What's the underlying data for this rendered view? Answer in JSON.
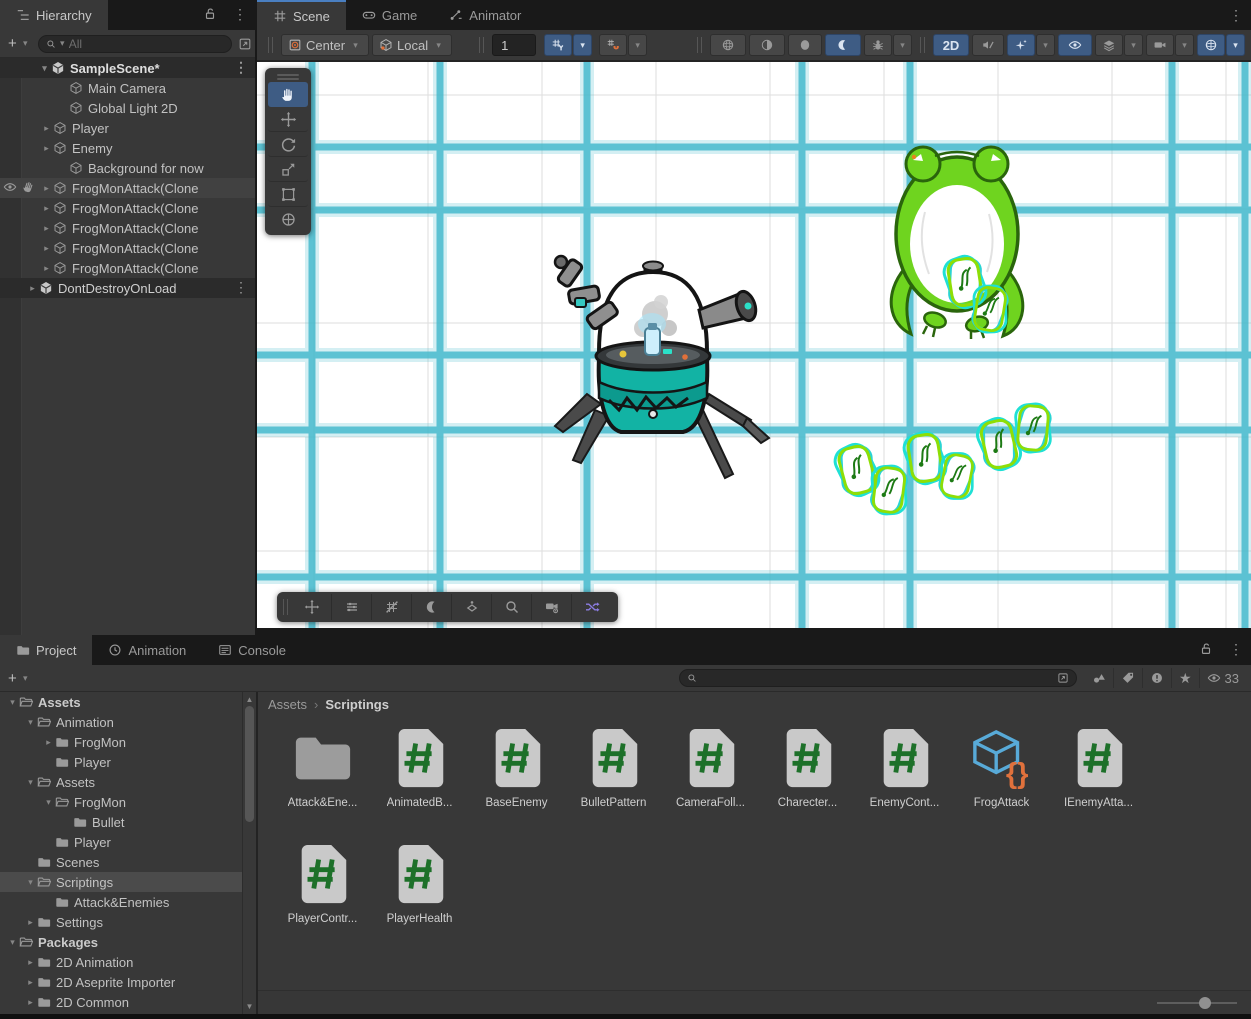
{
  "icons": {
    "kebab": "⋮",
    "caret": "▾",
    "tri_open": "▾",
    "tri_closed": "▸",
    "plus": "+",
    "star": "★",
    "crumb_sep": "›",
    "scroll_up": "▲",
    "scroll_down": "▼"
  },
  "hierarchy": {
    "tab_label": "Hierarchy",
    "search_placeholder": "All",
    "scene_header": "SampleScene*",
    "items": [
      {
        "label": "Main Camera"
      },
      {
        "label": "Global Light 2D"
      },
      {
        "label": "Player"
      },
      {
        "label": "Enemy"
      },
      {
        "label": "Background for now"
      },
      {
        "label": "FrogMonAttack(Clone"
      },
      {
        "label": "FrogMonAttack(Clone"
      },
      {
        "label": "FrogMonAttack(Clone"
      },
      {
        "label": "FrogMonAttack(Clone"
      },
      {
        "label": "FrogMonAttack(Clone"
      }
    ],
    "dontdestroy": "DontDestroyOnLoad"
  },
  "scene": {
    "tabs": {
      "scene": "Scene",
      "game": "Game",
      "animator": "Animator"
    },
    "toolbar": {
      "pivot": "Center",
      "space": "Local",
      "grid_value": "1",
      "mode_2d": "2D"
    }
  },
  "project": {
    "tabs": {
      "project": "Project",
      "animation": "Animation",
      "console": "Console"
    },
    "breadcrumb": {
      "root": "Assets",
      "current": "Scriptings"
    },
    "hidden_count": "33",
    "tree": [
      {
        "label": "Assets"
      },
      {
        "label": "Animation"
      },
      {
        "label": "FrogMon"
      },
      {
        "label": "Player"
      },
      {
        "label": "Assets"
      },
      {
        "label": "FrogMon"
      },
      {
        "label": "Bullet"
      },
      {
        "label": "Player"
      },
      {
        "label": "Scenes"
      },
      {
        "label": "Scriptings"
      },
      {
        "label": "Attack&Enemies"
      },
      {
        "label": "Settings"
      },
      {
        "label": "Packages"
      },
      {
        "label": "2D Animation"
      },
      {
        "label": "2D Aseprite Importer"
      },
      {
        "label": "2D Common"
      }
    ],
    "assets": [
      {
        "name": "Attack&Ene...",
        "type": "folder"
      },
      {
        "name": "AnimatedB...",
        "type": "script"
      },
      {
        "name": "BaseEnemy",
        "type": "script"
      },
      {
        "name": "BulletPattern",
        "type": "script"
      },
      {
        "name": "CameraFoll...",
        "type": "script"
      },
      {
        "name": "Charecter...",
        "type": "script"
      },
      {
        "name": "EnemyCont...",
        "type": "script"
      },
      {
        "name": "FrogAttack",
        "type": "asset"
      },
      {
        "name": "IEnemyAtta...",
        "type": "script"
      },
      {
        "name": "PlayerContr...",
        "type": "script"
      },
      {
        "name": "PlayerHealth",
        "type": "script"
      }
    ]
  },
  "colors": {
    "accent_blue": "#3e5c84",
    "tab_blue": "#4a7fc1",
    "script_green": "#1d7029",
    "orange": "#e0703a",
    "grid_cyan": "#3fb8cc",
    "bullet_cyan": "#1fe0d5",
    "bullet_green": "#8ede06",
    "frog_green": "#6fd41f",
    "robot_teal": "#12b3a4",
    "shuffle_purple": "#8b7ce0"
  }
}
